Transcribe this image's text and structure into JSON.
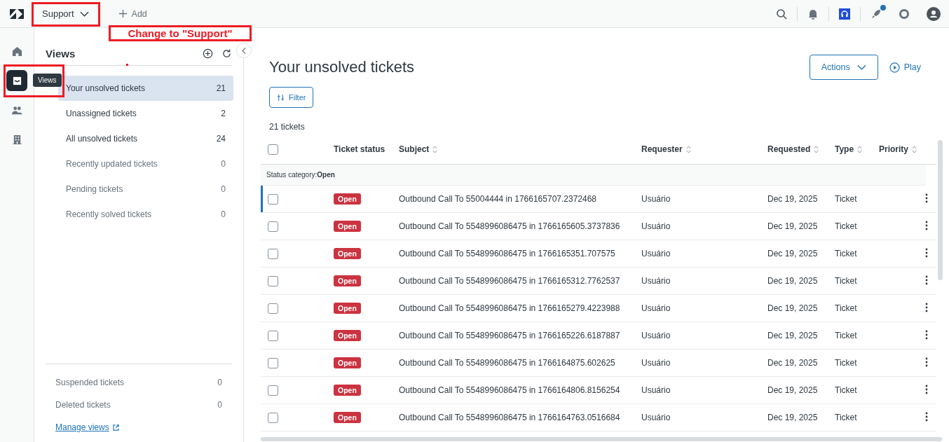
{
  "topbar": {
    "product": "Support",
    "add": "Add",
    "notification_dot": true
  },
  "rail": {
    "items": [
      {
        "kind": "home",
        "selected": false
      },
      {
        "kind": "views",
        "selected": true
      },
      {
        "kind": "users",
        "selected": false
      },
      {
        "kind": "orgs",
        "selected": false
      }
    ],
    "tooltip": "Views"
  },
  "views_panel": {
    "title": "Views",
    "items": [
      {
        "label": "Your unsolved tickets",
        "count": "21",
        "selected": true,
        "muted": false
      },
      {
        "label": "Unassigned tickets",
        "count": "2",
        "selected": false,
        "muted": false
      },
      {
        "label": "All unsolved tickets",
        "count": "24",
        "selected": false,
        "muted": false
      },
      {
        "label": "Recently updated tickets",
        "count": "0",
        "selected": false,
        "muted": true
      },
      {
        "label": "Pending tickets",
        "count": "0",
        "selected": false,
        "muted": true
      },
      {
        "label": "Recently solved tickets",
        "count": "0",
        "selected": false,
        "muted": true
      }
    ],
    "footer_items": [
      {
        "label": "Suspended tickets",
        "count": "0"
      },
      {
        "label": "Deleted tickets",
        "count": "0"
      }
    ],
    "manage_link": "Manage views"
  },
  "main": {
    "title": "Your unsolved tickets",
    "actions": "Actions",
    "play": "Play",
    "filter": "Filter",
    "count": "21 tickets",
    "columns": [
      "Ticket status",
      "Subject",
      "Requester",
      "Requested",
      "Type",
      "Priority"
    ],
    "select_all_checked": false,
    "group_label": "Status category: ",
    "group_value": "Open",
    "rows": [
      {
        "status": "Open",
        "subject": "Outbound Call To 55004444 in 1766165707.2372468",
        "requester": "Usuário",
        "requested": "Dec 19, 2025",
        "type": "Ticket",
        "checked": false,
        "focused": true
      },
      {
        "status": "Open",
        "subject": "Outbound Call To 5548996086475 in 1766165605.3737836",
        "requester": "Usuário",
        "requested": "Dec 19, 2025",
        "type": "Ticket",
        "checked": false,
        "focused": false
      },
      {
        "status": "Open",
        "subject": "Outbound Call To 5548996086475 in 1766165351.707575",
        "requester": "Usuário",
        "requested": "Dec 19, 2025",
        "type": "Ticket",
        "checked": false,
        "focused": false
      },
      {
        "status": "Open",
        "subject": "Outbound Call To 5548996086475 in 1766165312.7762537",
        "requester": "Usuário",
        "requested": "Dec 19, 2025",
        "type": "Ticket",
        "checked": false,
        "focused": false
      },
      {
        "status": "Open",
        "subject": "Outbound Call To 5548996086475 in 1766165279.4223988",
        "requester": "Usuário",
        "requested": "Dec 19, 2025",
        "type": "Ticket",
        "checked": false,
        "focused": false
      },
      {
        "status": "Open",
        "subject": "Outbound Call To 5548996086475 in 1766165226.6187887",
        "requester": "Usuário",
        "requested": "Dec 19, 2025",
        "type": "Ticket",
        "checked": false,
        "focused": false
      },
      {
        "status": "Open",
        "subject": "Outbound Call To 5548996086475 in 1766164875.602625",
        "requester": "Usuário",
        "requested": "Dec 19, 2025",
        "type": "Ticket",
        "checked": false,
        "focused": false
      },
      {
        "status": "Open",
        "subject": "Outbound Call To 5548996086475 in 1766164806.8156254",
        "requester": "Usuário",
        "requested": "Dec 19, 2025",
        "type": "Ticket",
        "checked": false,
        "focused": false
      },
      {
        "status": "Open",
        "subject": "Outbound Call To 5548996086475 in 1766164763.0516684",
        "requester": "Usuário",
        "requested": "Dec 19, 2025",
        "type": "Ticket",
        "checked": false,
        "focused": false
      }
    ]
  },
  "annotation": {
    "text": "Change to \"Support\""
  }
}
